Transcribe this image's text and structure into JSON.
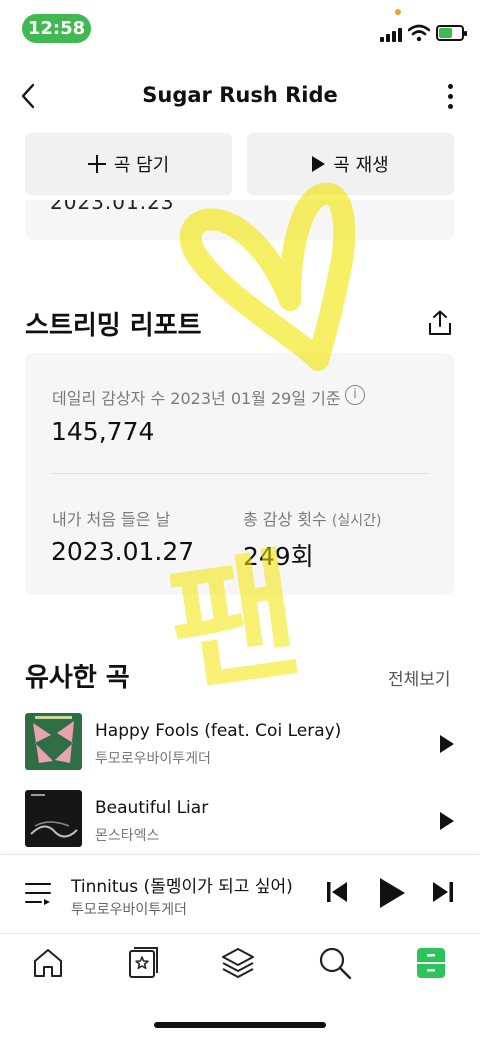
{
  "status_bar": {
    "time": "12:58",
    "battery_level": 0.6,
    "accent": "#3fb950"
  },
  "header": {
    "title": "Sugar Rush Ride",
    "back_icon": "chevron-left-icon",
    "more_icon": "more-vertical-icon"
  },
  "actions": {
    "add_label": "곡 담기",
    "play_label": "곡 재생"
  },
  "previous_card": {
    "partial_text": "2023.01.23"
  },
  "report": {
    "title": "스트리밍 리포트",
    "daily_label": "데일리 감상자 수 2023년 01월 29일 기준",
    "info_symbol": "i",
    "daily_value": "145,774",
    "first_listen_label": "내가 처음 들은 날",
    "first_listen_value": "2023.01.27",
    "total_label": "총 감상 횟수",
    "total_label_note": "(실시간)",
    "total_value": "249회"
  },
  "similar": {
    "title": "유사한 곡",
    "see_all": "전체보기",
    "songs": [
      {
        "title": "Happy Fools (feat. Coi Leray)",
        "artist": "투모로우바이투게더"
      },
      {
        "title": "Beautiful Liar",
        "artist": "몬스타엑스"
      }
    ]
  },
  "mini_player": {
    "title": "Tinnitus (돌멩이가 되고 싶어)",
    "artist": "투모로우바이투게더"
  },
  "bottom_nav": {
    "items": [
      "home-icon",
      "star-card-icon",
      "layers-icon",
      "search-icon",
      "library-icon"
    ],
    "active": 4,
    "active_color": "#2cc45a"
  },
  "overlay_text": "팬"
}
